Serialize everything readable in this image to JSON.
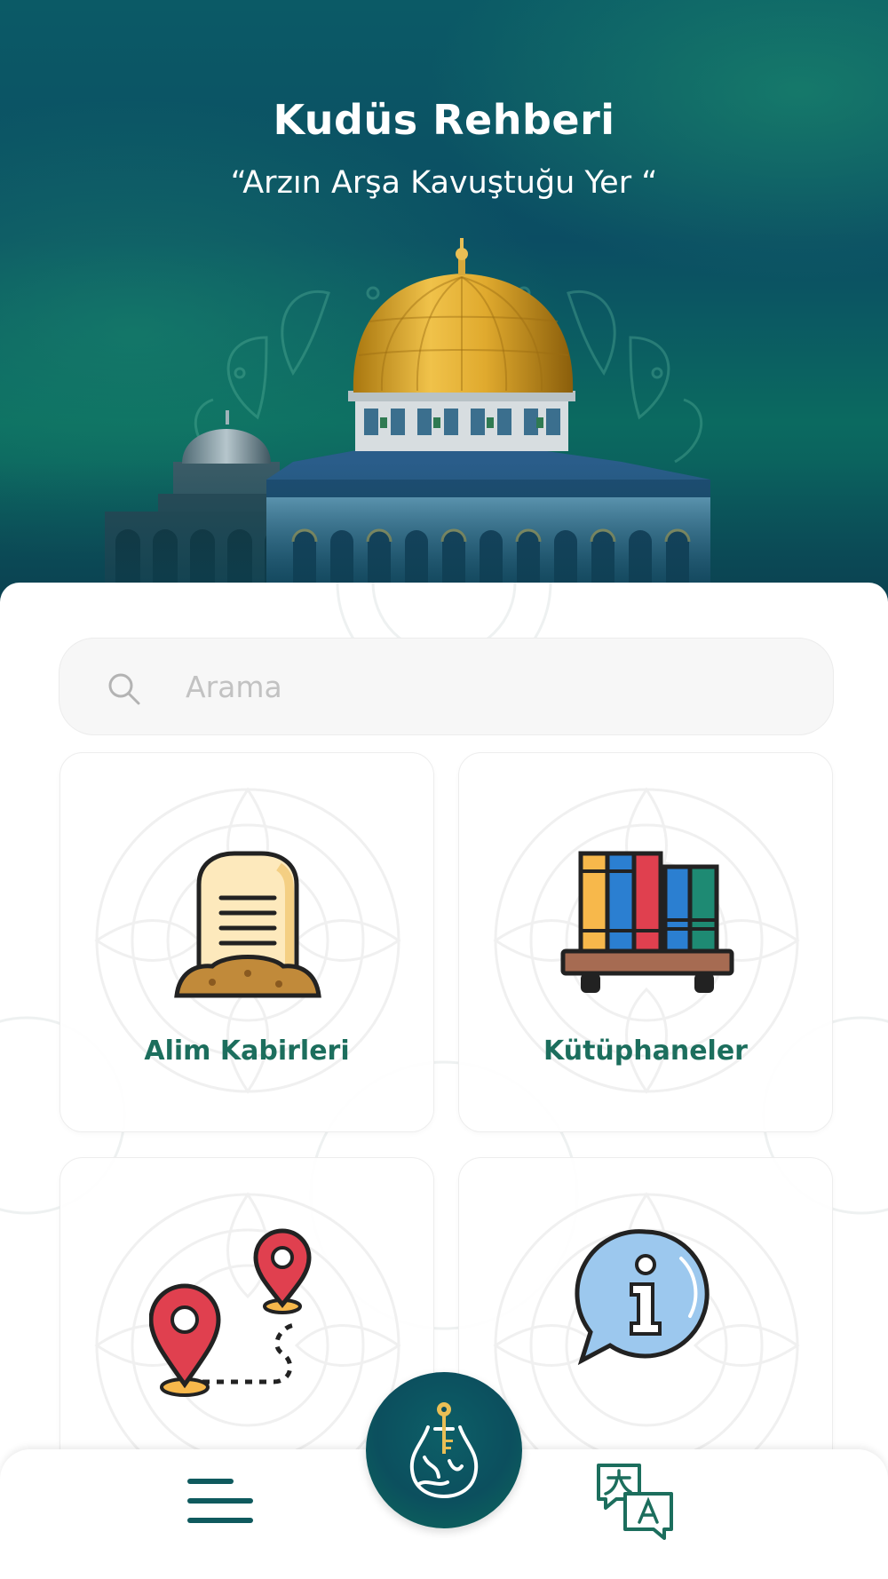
{
  "header": {
    "title": "Kudüs Rehberi",
    "subtitle": "“Arzın Arşa Kavuştuğu Yer “"
  },
  "search": {
    "placeholder": "Arama"
  },
  "cards": [
    {
      "label": "Alim Kabirleri",
      "icon": "tombstone-icon"
    },
    {
      "label": "Kütüphaneler",
      "icon": "books-icon"
    },
    {
      "label": "",
      "icon": "map-route-icon"
    },
    {
      "label": "",
      "icon": "info-bubble-icon"
    }
  ],
  "bottom_nav": {
    "menu_icon": "hamburger-menu-icon",
    "home_icon": "app-logo-icon",
    "language_icon": "translate-icon"
  },
  "colors": {
    "brand_teal": "#0c4f5e",
    "label_green": "#1c6e5d",
    "hero_green": "#1a8c6e"
  }
}
